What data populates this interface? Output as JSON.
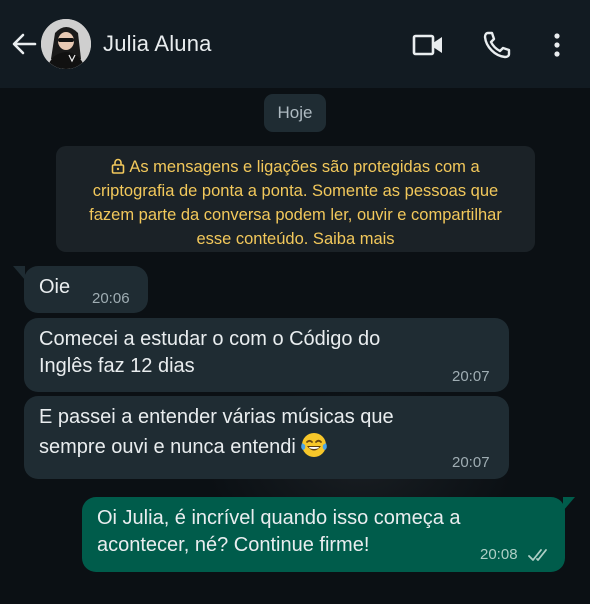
{
  "header": {
    "contact_name": "Julia Aluna",
    "icons": [
      "back-arrow-icon",
      "video-call-icon",
      "voice-call-icon",
      "more-options-icon"
    ]
  },
  "chat": {
    "date_chip": "Hoje",
    "encryption_notice": {
      "icon": "lock-icon",
      "lines": [
        "As mensagens e ligações são protegidas com a",
        "criptografia de ponta a ponta. Somente as pessoas que",
        "fazem parte da conversa podem ler, ouvir e compartilhar",
        "esse conteúdo. Saiba mais"
      ]
    },
    "messages": [
      {
        "direction": "incoming",
        "lines": [
          "Oie"
        ],
        "time": "20:06"
      },
      {
        "direction": "incoming",
        "lines": [
          "Comecei a estudar o com o Código do",
          "Inglês faz 12 dias"
        ],
        "time": "20:07"
      },
      {
        "direction": "incoming",
        "lines": [
          "E passei a entender várias músicas que",
          "sempre ouvi e nunca entendi"
        ],
        "emoji": "tears-of-joy-emoji",
        "time": "20:07"
      },
      {
        "direction": "outgoing",
        "lines": [
          "Oi Julia, é incrível quando isso começa a",
          "acontecer, né? Continue firme!"
        ],
        "time": "20:08",
        "status_icon": "read-double-check-icon"
      }
    ]
  },
  "colors": {
    "header_bg": "#121b22",
    "chat_bg": "#0b1014",
    "incoming_bubble": "#1f2c33",
    "outgoing_bubble": "#005c4b",
    "notice_text": "#f2c85b",
    "primary_text": "#e9edef"
  }
}
